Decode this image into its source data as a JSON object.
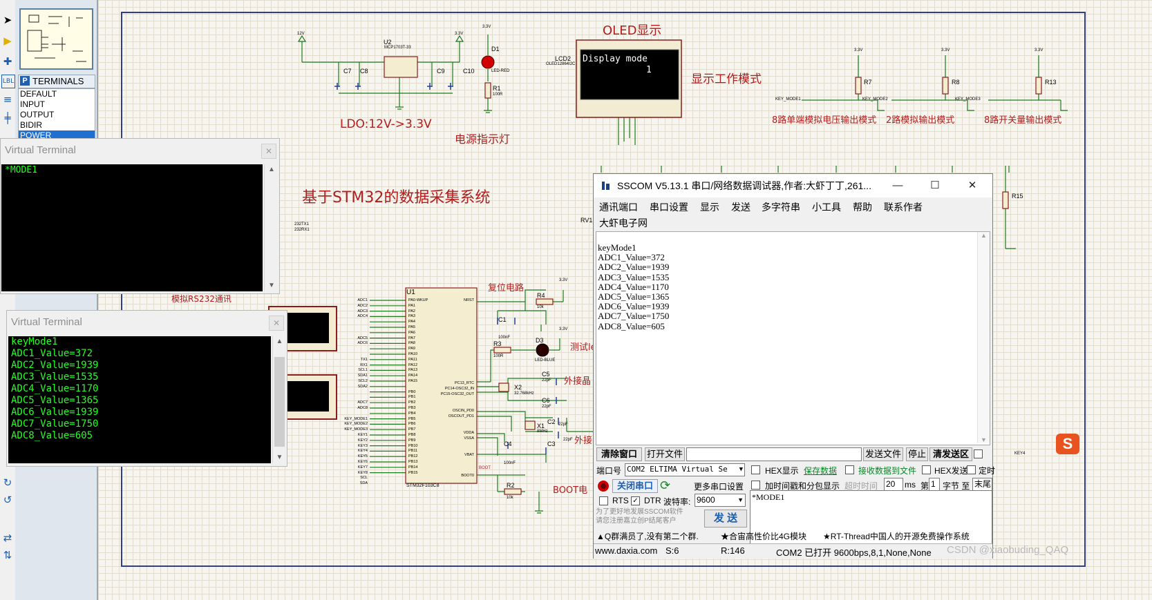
{
  "sheet": {
    "title_main": "基于STM32的数据采集系统",
    "oled_title": "OLED显示",
    "oled_mode_label": "显示工作模式",
    "ldo_label": "LDO:12V->3.3V",
    "power_led_label": "电源指示灯",
    "rs232_label": "模拟RS232通讯",
    "reset_label": "复位电路",
    "test_led_label": "测试le",
    "ext_crystal1": "外接晶",
    "ext_crystal2": "外接",
    "boot_label": "BOOT电",
    "mode1_label": "8路单端模拟电压输出模式",
    "mode2_label": "2路模拟输出模式",
    "mode3_label": "8路开关量输出模式",
    "oled_lines": [
      "Display mode",
      "1"
    ],
    "mcu_ref": "U1",
    "mcu_part": "STM32F103C8",
    "ldo_ref": "U2",
    "ldo_part": "MCP1703T-33",
    "lcd_ref": "LCD2",
    "lcd_part": "OLED12864I2C",
    "watermark": "CSDN @xiaobuding_QAQ"
  },
  "sheet_labels": {
    "d1": "D1",
    "led_red": "LED-RED",
    "r1": "R1",
    "r1v": "100R",
    "c7": "C7",
    "c8": "C8",
    "c9": "C9",
    "c10": "C10",
    "r4": "R4",
    "r4v": "10k",
    "c1": "C1",
    "c1v": "100nF",
    "r3": "R3",
    "r3v": "100R",
    "d3": "D3",
    "led_blue": "LED-BLUE",
    "c5": "C5",
    "c5v": "22pF",
    "x2": "X2",
    "x2v": "32.768kHz",
    "c6": "C6",
    "c6v": "22pF",
    "x1": "X1",
    "x1v": "8MHz",
    "c2": "C2",
    "c2v": "22pF",
    "c3": "C3",
    "c3v": "22pF",
    "c4": "C4",
    "c4v": "100nF",
    "r2": "R2",
    "r2v": "10k",
    "r7": "R7",
    "r8": "R8",
    "r13": "R13",
    "r15": "R15",
    "rv1": "RV1",
    "key_mode1": "KEY_MODE1",
    "key_mode2": "KEY_MODE2",
    "key_mode3": "KEY_MODE3",
    "v33": "3.3V",
    "v12": "12V",
    "boot": "BOOT",
    "key4": "KEY4",
    "tx": "232TX1",
    "rx": "232RX1"
  },
  "pin_labels_left": [
    "ADC1",
    "ADC2",
    "ADC3",
    "ADC4",
    "",
    "",
    "",
    "ADC5",
    "ADC6",
    "",
    "",
    "TX1",
    "RX1",
    "SCL1",
    "SDA1",
    "SCL2",
    "SDA2",
    "",
    "",
    "ADC7",
    "ADC8",
    "",
    "KEY_MODE1",
    "KEY_MODE2",
    "KEY_MODE3",
    "KEY1",
    "KEY2",
    "KEY3",
    "KEY4",
    "KEY5",
    "KEY6",
    "KEY7",
    "KEY8",
    "SCL",
    "SDA"
  ],
  "mcu_pins_left": [
    "PA0-WKUP",
    "PA1",
    "PA2",
    "PA3",
    "PA4",
    "PA5",
    "PA6",
    "PA7",
    "PA8",
    "PA9",
    "PA10",
    "PA11",
    "PA12",
    "PA13",
    "PA14",
    "PA15",
    "",
    "PB0",
    "PB1",
    "PB2",
    "PB3",
    "PB4",
    "PB5",
    "PB6",
    "PB7",
    "PB8",
    "PB9",
    "PB10",
    "PB11",
    "PB12",
    "PB13",
    "PB14",
    "PB15"
  ],
  "mcu_pins_right": [
    "NRST",
    "PC13_RTC",
    "PC14-OSC32_IN",
    "PC15-OSC32_OUT",
    "OSCIN_PD0",
    "OSCOUT_PD1",
    "VDDA",
    "VSSA",
    "VBAT",
    "BOOT0"
  ],
  "devices": {
    "tab_label": "TERMINALS",
    "tab_letter": "P",
    "items": [
      "DEFAULT",
      "INPUT",
      "OUTPUT",
      "BIDIR",
      "POWER"
    ],
    "selected": "POWER"
  },
  "vt1": {
    "title": "Virtual Terminal",
    "lines": [
      "*MODE1"
    ]
  },
  "vt2": {
    "title": "Virtual Terminal",
    "lines": [
      "keyMode1",
      "ADC1_Value=372",
      "ADC2_Value=1939",
      "ADC3_Value=1535",
      "ADC4_Value=1170",
      "ADC5_Value=1365",
      "ADC6_Value=1939",
      "ADC7_Value=1750",
      "ADC8_Value=605"
    ]
  },
  "sscom": {
    "title": "SSCOM V5.13.1 串口/网络数据调试器,作者:大虾丁丁,261...",
    "menu": [
      "通讯端口",
      "串口设置",
      "显示",
      "发送",
      "多字符串",
      "小工具",
      "帮助",
      "联系作者",
      "大虾电子网"
    ],
    "recv_lines": [
      "keyMode1",
      "ADC1_Value=372",
      "ADC2_Value=1939",
      "ADC3_Value=1535",
      "ADC4_Value=1170",
      "ADC5_Value=1365",
      "ADC6_Value=1939",
      "ADC7_Value=1750",
      "ADC8_Value=605"
    ],
    "btn_clear": "清除窗口",
    "btn_openfile": "打开文件",
    "btn_sendfile": "发送文件",
    "btn_stop": "停止",
    "btn_clear_send": "清发送区",
    "port_label": "端口号",
    "port_value": "COM2 ELTIMA Virtual Se",
    "hex_display": "HEX显示",
    "save_data": "保存数据",
    "recv_to_file": "接收数据到文件",
    "hex_send": "HEX发送",
    "timing": "定时",
    "btn_close_port": "关闭串口",
    "more_settings": "更多串口设置",
    "timestamp": "加时间戳和分包显示",
    "timeout_label": "超时时间",
    "timeout_value": "20",
    "ms": "ms",
    "nth": "第",
    "byte_value": "1",
    "byte_label": "字节 至",
    "end_value": "末尾",
    "rts": "RTS",
    "dtr": "DTR",
    "baud_label": "波特率:",
    "baud_value": "9600",
    "send_text": "*MODE1",
    "btn_send": "发 送",
    "promo": "为了更好地发展SSCOM软件\n请您注册嘉立创P结尾客户",
    "ticker": [
      "▲Q群满员了,没有第二个群.",
      "★合宙高性价比4G模块",
      "★RT-Thread中国人的开源免费操作系统"
    ],
    "status": {
      "website": "www.daxia.com",
      "s": "S:6",
      "r": "R:146",
      "port": "COM2 已打开  9600bps,8,1,None,None"
    }
  }
}
